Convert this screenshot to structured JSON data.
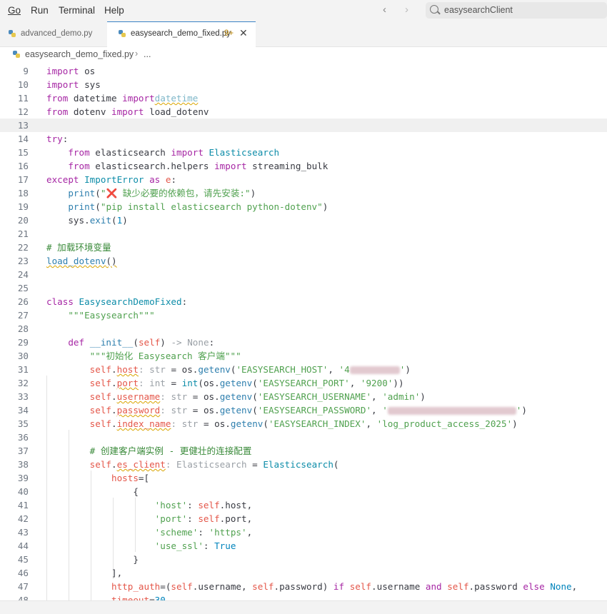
{
  "menu": [
    "Go",
    "Run",
    "Terminal",
    "Help"
  ],
  "search": {
    "placeholder": "easysearchClient"
  },
  "tabs": [
    {
      "label": "advanced_demo.py",
      "active": false,
      "problems": ""
    },
    {
      "label": "easysearch_demo_fixed.py",
      "active": true,
      "problems": "9+"
    }
  ],
  "breadcrumb": {
    "file": "easysearch_demo_fixed.py",
    "more": "..."
  },
  "icons": {
    "python_file": "python-file-icon",
    "close": "close-icon",
    "back": "arrow-left-icon",
    "forward": "arrow-right-icon",
    "search": "search-icon",
    "breadcrumb_sep": "chevron-right-icon"
  },
  "colors": {
    "keyword": "#a626a4",
    "string": "#50a14f",
    "class": "#0c8ca8",
    "self": "#e45649",
    "comment": "#3a8a3a",
    "active_tab_border": "#3b82c4",
    "current_line": "#f0f0f0"
  },
  "editor": {
    "lines": [
      {
        "n": "9",
        "t": [
          [
            "kw",
            "import"
          ],
          [
            "",
            "&nbsp;os"
          ]
        ]
      },
      {
        "n": "10",
        "t": [
          [
            "kw",
            "import"
          ],
          [
            "",
            "&nbsp;sys"
          ]
        ]
      },
      {
        "n": "11",
        "t": [
          [
            "kw",
            "from"
          ],
          [
            "",
            "&nbsp;datetime&nbsp;"
          ],
          [
            "kw",
            "import"
          ],
          [
            "",
            ""
          ],
          [
            "ghost warn",
            "datetime"
          ]
        ]
      },
      {
        "n": "12",
        "t": [
          [
            "kw",
            "from"
          ],
          [
            "",
            "&nbsp;dotenv&nbsp;"
          ],
          [
            "kw",
            "import"
          ],
          [
            "",
            "&nbsp;load_dotenv"
          ]
        ]
      },
      {
        "n": "13",
        "t": [],
        "current": true
      },
      {
        "n": "14",
        "t": [
          [
            "kw",
            "try"
          ],
          [
            "",
            ":"
          ]
        ]
      },
      {
        "n": "15",
        "t": [
          [
            "",
            "    "
          ],
          [
            "kw",
            "from"
          ],
          [
            "",
            "&nbsp;elasticsearch&nbsp;"
          ],
          [
            "kw",
            "import"
          ],
          [
            "",
            "&nbsp;"
          ],
          [
            "cls",
            "Elasticsearch"
          ]
        ]
      },
      {
        "n": "16",
        "t": [
          [
            "",
            "    "
          ],
          [
            "kw",
            "from"
          ],
          [
            "",
            "&nbsp;elasticsearch.helpers&nbsp;"
          ],
          [
            "kw",
            "import"
          ],
          [
            "",
            "&nbsp;streaming_bulk"
          ]
        ]
      },
      {
        "n": "17",
        "t": [
          [
            "kw",
            "except"
          ],
          [
            "",
            "&nbsp;"
          ],
          [
            "cls",
            "ImportError"
          ],
          [
            "",
            "&nbsp;"
          ],
          [
            "kw",
            "as"
          ],
          [
            "",
            "&nbsp;"
          ],
          [
            "self",
            "e"
          ],
          [
            "",
            ":"
          ]
        ]
      },
      {
        "n": "18",
        "t": [
          [
            "",
            "    "
          ],
          [
            "fn",
            "print"
          ],
          [
            "",
            "("
          ],
          [
            "st",
            "\"❌ 缺少必要的依赖包，请先安装:\""
          ],
          [
            "",
            ")"
          ]
        ]
      },
      {
        "n": "19",
        "t": [
          [
            "",
            "    "
          ],
          [
            "fn",
            "print"
          ],
          [
            "",
            "("
          ],
          [
            "st",
            "\"pip install elasticsearch python-dotenv\""
          ],
          [
            "",
            ")"
          ]
        ]
      },
      {
        "n": "20",
        "t": [
          [
            "",
            "    "
          ],
          [
            "",
            "sys."
          ],
          [
            "fn",
            "exit"
          ],
          [
            "",
            "("
          ],
          [
            "num",
            "1"
          ],
          [
            "",
            ")"
          ]
        ]
      },
      {
        "n": "21",
        "t": []
      },
      {
        "n": "22",
        "t": [
          [
            "cm",
            "# 加载环境变量"
          ]
        ]
      },
      {
        "n": "23",
        "t": [
          [
            "fn warn",
            "load_dotenv"
          ],
          [
            "warn",
            "()"
          ]
        ]
      },
      {
        "n": "24",
        "t": []
      },
      {
        "n": "25",
        "t": []
      },
      {
        "n": "26",
        "t": [
          [
            "kw",
            "class"
          ],
          [
            "",
            "&nbsp;"
          ],
          [
            "cls",
            "EasysearchDemoFixed"
          ],
          [
            "",
            ":"
          ]
        ]
      },
      {
        "n": "27",
        "t": [
          [
            "",
            "    "
          ],
          [
            "st",
            "\"\"\"Easysearch\"\"\""
          ]
        ]
      },
      {
        "n": "28",
        "t": []
      },
      {
        "n": "29",
        "t": [
          [
            "",
            "    "
          ],
          [
            "kw",
            "def"
          ],
          [
            "",
            "&nbsp;"
          ],
          [
            "fn",
            "__init__"
          ],
          [
            "",
            "("
          ],
          [
            "self",
            "self"
          ],
          [
            "",
            ")"
          ],
          [
            "hint",
            "&nbsp;-&gt;&nbsp;None"
          ],
          [
            "",
            ":"
          ]
        ]
      },
      {
        "n": "30",
        "t": [
          [
            "",
            "        "
          ],
          [
            "st",
            "\"\"\"初始化 Easysearch 客户端\"\"\""
          ]
        ]
      },
      {
        "n": "31",
        "t": [
          [
            "",
            "        "
          ],
          [
            "self",
            "self"
          ],
          [
            "",
            "."
          ],
          [
            "self warn",
            "host"
          ],
          [
            "hint",
            ":&nbsp;str"
          ],
          [
            "",
            "&nbsp;=&nbsp;os."
          ],
          [
            "fn",
            "getenv"
          ],
          [
            "",
            "("
          ],
          [
            "st",
            "'EASYSEARCH_HOST'"
          ],
          [
            "",
            ",&nbsp;"
          ],
          [
            "st",
            "'4"
          ],
          [
            "blur",
            "70"
          ],
          [
            "st",
            "'"
          ],
          [
            "",
            ")"
          ]
        ]
      },
      {
        "n": "32",
        "t": [
          [
            "",
            "        "
          ],
          [
            "self",
            "self"
          ],
          [
            "",
            "."
          ],
          [
            "self warn",
            "port"
          ],
          [
            "hint",
            ":&nbsp;int"
          ],
          [
            "",
            "&nbsp;=&nbsp;"
          ],
          [
            "cls",
            "int"
          ],
          [
            "",
            "(os."
          ],
          [
            "fn",
            "getenv"
          ],
          [
            "",
            "("
          ],
          [
            "st",
            "'EASYSEARCH_PORT'"
          ],
          [
            "",
            ",&nbsp;"
          ],
          [
            "st",
            "'9200'"
          ],
          [
            "",
            "))"
          ]
        ]
      },
      {
        "n": "33",
        "t": [
          [
            "",
            "        "
          ],
          [
            "self",
            "self"
          ],
          [
            "",
            "."
          ],
          [
            "self warn",
            "username"
          ],
          [
            "hint",
            ":&nbsp;str"
          ],
          [
            "",
            "&nbsp;=&nbsp;os."
          ],
          [
            "fn",
            "getenv"
          ],
          [
            "",
            "("
          ],
          [
            "st",
            "'EASYSEARCH_USERNAME'"
          ],
          [
            "",
            ",&nbsp;"
          ],
          [
            "st",
            "'admin'"
          ],
          [
            "",
            ")"
          ]
        ]
      },
      {
        "n": "34",
        "t": [
          [
            "",
            "        "
          ],
          [
            "self",
            "self"
          ],
          [
            "",
            "."
          ],
          [
            "self warn",
            "password"
          ],
          [
            "hint",
            ":&nbsp;str"
          ],
          [
            "",
            "&nbsp;=&nbsp;os."
          ],
          [
            "fn",
            "getenv"
          ],
          [
            "",
            "("
          ],
          [
            "st",
            "'EASYSEARCH_PASSWORD'"
          ],
          [
            "",
            ",&nbsp;"
          ],
          [
            "st",
            "'"
          ],
          [
            "blur",
            "180"
          ],
          [
            "st",
            "'"
          ],
          [
            "",
            ")"
          ]
        ]
      },
      {
        "n": "35",
        "t": [
          [
            "",
            "        "
          ],
          [
            "self",
            "self"
          ],
          [
            "",
            "."
          ],
          [
            "self warn",
            "index_name"
          ],
          [
            "hint",
            ":&nbsp;str"
          ],
          [
            "",
            "&nbsp;=&nbsp;os."
          ],
          [
            "fn",
            "getenv"
          ],
          [
            "",
            "("
          ],
          [
            "st",
            "'EASYSEARCH_INDEX'"
          ],
          [
            "",
            ",&nbsp;"
          ],
          [
            "st",
            "'log_product_access_2025'"
          ],
          [
            "",
            ")"
          ]
        ]
      },
      {
        "n": "36",
        "t": []
      },
      {
        "n": "37",
        "t": [
          [
            "",
            "        "
          ],
          [
            "cm",
            "# 创建客户端实例 - 更健壮的连接配置"
          ]
        ]
      },
      {
        "n": "38",
        "t": [
          [
            "",
            "        "
          ],
          [
            "self",
            "self"
          ],
          [
            "",
            "."
          ],
          [
            "self warn",
            "es_client"
          ],
          [
            "hint",
            ":&nbsp;Elasticsearch"
          ],
          [
            "",
            "&nbsp;=&nbsp;"
          ],
          [
            "cls",
            "Elasticsearch"
          ],
          [
            "",
            "("
          ]
        ]
      },
      {
        "n": "39",
        "t": [
          [
            "",
            "            "
          ],
          [
            "self",
            "hosts"
          ],
          [
            "",
            "=["
          ]
        ]
      },
      {
        "n": "40",
        "t": [
          [
            "",
            "                "
          ],
          [
            "",
            "{"
          ]
        ]
      },
      {
        "n": "41",
        "t": [
          [
            "",
            "                    "
          ],
          [
            "st",
            "'host'"
          ],
          [
            "",
            ":&nbsp;"
          ],
          [
            "self",
            "self"
          ],
          [
            "",
            ".host,"
          ]
        ]
      },
      {
        "n": "42",
        "t": [
          [
            "",
            "                    "
          ],
          [
            "st",
            "'port'"
          ],
          [
            "",
            ":&nbsp;"
          ],
          [
            "self",
            "self"
          ],
          [
            "",
            ".port,"
          ]
        ]
      },
      {
        "n": "43",
        "t": [
          [
            "",
            "                    "
          ],
          [
            "st",
            "'scheme'"
          ],
          [
            "",
            ":&nbsp;"
          ],
          [
            "st",
            "'https'"
          ],
          [
            "",
            ","
          ]
        ]
      },
      {
        "n": "44",
        "t": [
          [
            "",
            "                    "
          ],
          [
            "st",
            "'use_ssl'"
          ],
          [
            "",
            ":&nbsp;"
          ],
          [
            "num",
            "True"
          ]
        ]
      },
      {
        "n": "45",
        "t": [
          [
            "",
            "                "
          ],
          [
            "",
            "}"
          ]
        ]
      },
      {
        "n": "46",
        "t": [
          [
            "",
            "            "
          ],
          [
            "",
            "],"
          ]
        ]
      },
      {
        "n": "47",
        "t": [
          [
            "",
            "            "
          ],
          [
            "self",
            "http_auth"
          ],
          [
            "",
            "=("
          ],
          [
            "self",
            "self"
          ],
          [
            "",
            ".username,&nbsp;"
          ],
          [
            "self",
            "self"
          ],
          [
            "",
            ".password)&nbsp;"
          ],
          [
            "kw",
            "if"
          ],
          [
            "",
            "&nbsp;"
          ],
          [
            "self",
            "self"
          ],
          [
            "",
            ".username&nbsp;"
          ],
          [
            "kw",
            "and"
          ],
          [
            "",
            "&nbsp;"
          ],
          [
            "self",
            "self"
          ],
          [
            "",
            ".password&nbsp;"
          ],
          [
            "kw",
            "else"
          ],
          [
            "",
            "&nbsp;"
          ],
          [
            "num",
            "None"
          ],
          [
            "",
            ","
          ]
        ]
      },
      {
        "n": "48",
        "t": [
          [
            "",
            "            "
          ],
          [
            "self",
            "timeout"
          ],
          [
            "",
            "="
          ],
          [
            "num",
            "30"
          ]
        ]
      }
    ]
  }
}
